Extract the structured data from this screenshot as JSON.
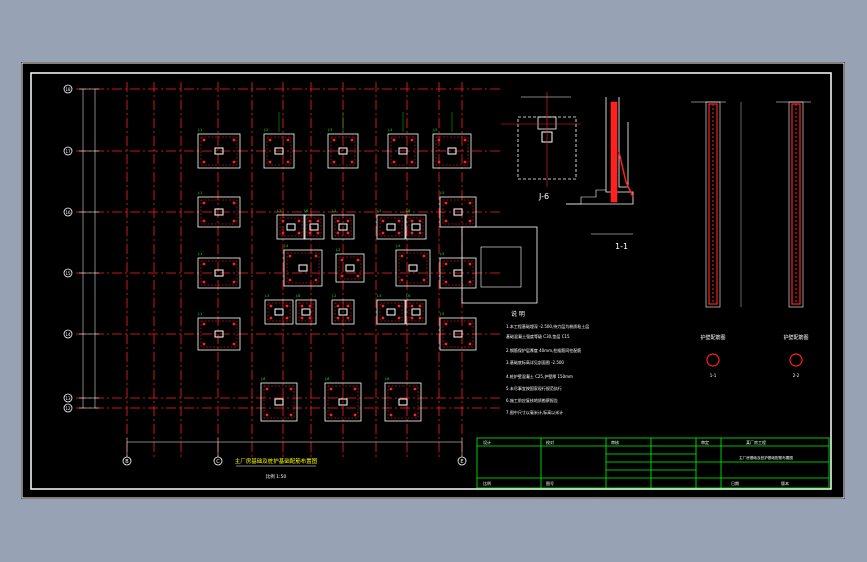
{
  "drawing": {
    "plan_title": "主厂房基础及桩护基础配筋布置图",
    "plan_scale": "比例 1:50",
    "notes_title": "说 明",
    "notes": [
      "1.本工程基础埋深 -2.500,持力层为粉质粘土层",
      "  基础混凝土强度等级 C30,垫层 C15",
      "2.钢筋保护层厚度 40mm,柱插筋同柱配筋",
      "3.基础底标高详见剖面图 -2.500",
      "4.桩护壁混凝土 C25,护壁厚 150mm",
      "5.未尽事宜按国家现行规范执行",
      "6.施工前应复核地质勘察报告",
      "7.图中尺寸以毫米计,标高以米计"
    ],
    "section_labels": [
      "J-6",
      "1-1"
    ],
    "detail_labels": [
      "护壁配筋图",
      "护壁配筋图"
    ],
    "detail_marks": [
      "1-1",
      "2-2"
    ],
    "axis_row_labels": [
      "18",
      "17",
      "16",
      "15",
      "14",
      "13",
      "12"
    ],
    "axis_col_labels": [
      "B",
      "C",
      "E"
    ],
    "footing_tags": [
      "J-1",
      "J-2",
      "J-3",
      "J-4",
      "J-5",
      "J-6"
    ],
    "title_block": {
      "project": "某厂房工程",
      "drawing_name": "主厂房基础及桩护基础配筋布置图",
      "cells": [
        "设计",
        "校对",
        "审核",
        "审定",
        "比例",
        "图号",
        "日期",
        "版本"
      ]
    }
  },
  "colors": {
    "background": "#97a3b4",
    "sheet": "#000000",
    "frame": "#ffffff",
    "axis": "#ff2020",
    "geometry": "#ffffff",
    "rebar": "#ff2020",
    "titleblock": "#00ff00",
    "dimension": "#00ffff"
  }
}
